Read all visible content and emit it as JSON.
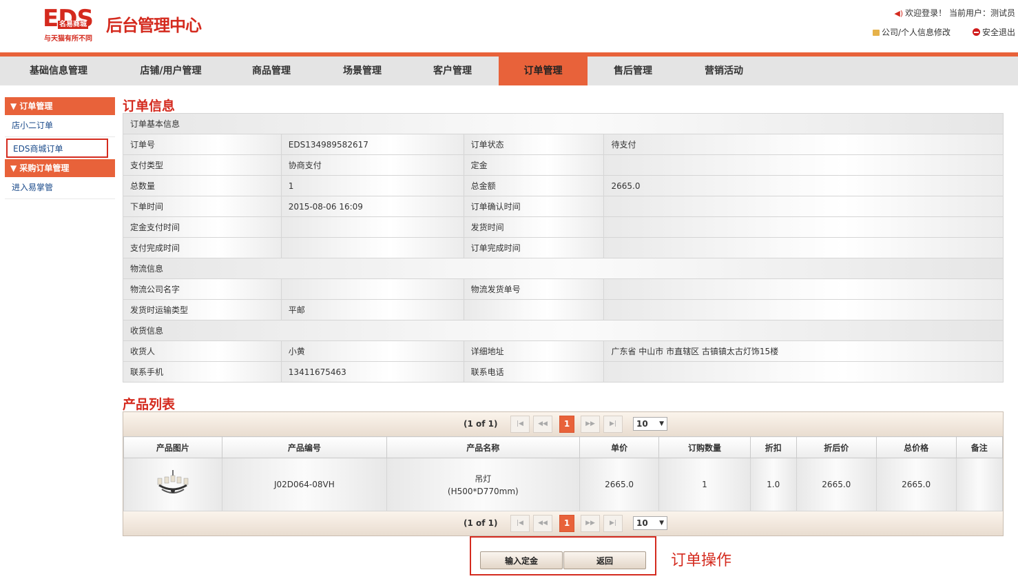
{
  "header": {
    "logo_text": "EDS",
    "logo_cn": "名易商城",
    "slogan": "与天猫有所不同",
    "site_title": "后台管理中心",
    "welcome": "欢迎登录！ 当前用户：测试员",
    "profile_link": "公司/个人信息修改",
    "logout_link": "安全退出"
  },
  "nav": {
    "items": [
      "基础信息管理",
      "店铺/用户管理",
      "商品管理",
      "场景管理",
      "客户管理",
      "订单管理",
      "售后管理",
      "营销活动"
    ],
    "active": "订单管理",
    "accent": "#e8623a"
  },
  "sidebar": {
    "group1": "▼ 订单管理",
    "item1": "店小二订单",
    "item2": "EDS商城订单",
    "group2": "▼ 采购订单管理",
    "item3": "进入易掌管"
  },
  "order": {
    "title": "订单信息",
    "basic_section": "订单基本信息",
    "order_no_label": "订单号",
    "order_no": "EDS134989582617",
    "status_label": "订单状态",
    "status": "待支付",
    "pay_type_label": "支付类型",
    "pay_type": "协商支付",
    "deposit_label": "定金",
    "deposit": "",
    "qty_label": "总数量",
    "qty": "1",
    "amount_label": "总金额",
    "amount": "2665.0",
    "order_time_label": "下单时间",
    "order_time": "2015-08-06 16:09",
    "confirm_time_label": "订单确认时间",
    "confirm_time": "",
    "deposit_time_label": "定金支付时间",
    "deposit_time": "",
    "ship_time_label": "发货时间",
    "ship_time": "",
    "paid_time_label": "支付完成时间",
    "paid_time": "",
    "done_time_label": "订单完成时间",
    "done_time": "",
    "logistics_section": "物流信息",
    "carrier_label": "物流公司名字",
    "carrier": "",
    "tracking_label": "物流发货单号",
    "tracking": "",
    "ship_type_label": "发货时运输类型",
    "ship_type": "平邮",
    "receiver_section": "收货信息",
    "receiver_label": "收货人",
    "receiver": "小黄",
    "address_label": "详细地址",
    "address": "广东省 中山市 市直辖区 古镇镇太古灯饰15楼",
    "mobile_label": "联系手机",
    "mobile": "13411675463",
    "phone_label": "联系电话",
    "phone": ""
  },
  "products": {
    "title": "产品列表",
    "page_info": "(1 of 1)",
    "current_page": "1",
    "page_size": "10",
    "columns": [
      "产品图片",
      "产品编号",
      "产品名称",
      "单价",
      "订购数量",
      "折扣",
      "折后价",
      "总价格",
      "备注"
    ],
    "rows": [
      {
        "image_icon": "chandelier-thumbnail",
        "code": "J02D064-08VH",
        "name": "吊灯",
        "spec": "(H500*D770mm)",
        "price": "2665.0",
        "qty": "1",
        "discount": "1.0",
        "discount_price": "2665.0",
        "total": "2665.0",
        "remark": ""
      }
    ]
  },
  "actions": {
    "deposit_button": "输入定金",
    "back_button": "返回",
    "annotation": "订单操作"
  }
}
